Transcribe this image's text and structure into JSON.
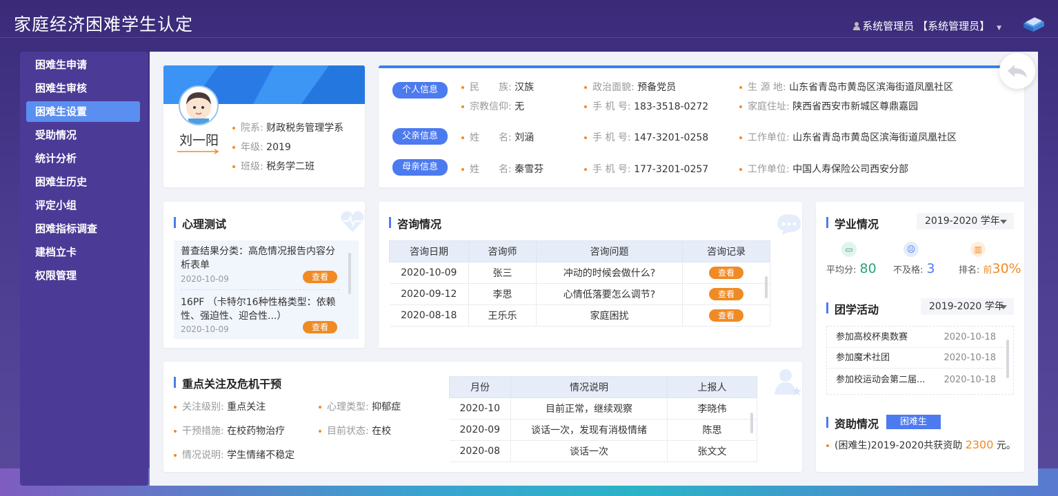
{
  "header": {
    "title": "家庭经济困难学生认定",
    "user": "系统管理员 【系统管理员】"
  },
  "sidebar": {
    "items": [
      {
        "label": "困难生申请"
      },
      {
        "label": "困难生审核"
      },
      {
        "label": "困难生设置"
      },
      {
        "label": "受助情况"
      },
      {
        "label": "统计分析"
      },
      {
        "label": "困难生历史"
      },
      {
        "label": "评定小组"
      },
      {
        "label": "困难指标调查"
      },
      {
        "label": "建档立卡"
      },
      {
        "label": "权限管理"
      }
    ],
    "active_index": 2
  },
  "profile": {
    "name": "刘一阳",
    "dept_label": "院系:",
    "dept": "财政税务管理学系",
    "grade_label": "年级:",
    "grade": "2019",
    "class_label": "班级:",
    "class": "税务学二班"
  },
  "personal": {
    "tag": "个人信息",
    "ethnic_label": "民　　族:",
    "ethnic": "汉族",
    "political_label": "政治面貌:",
    "political": "预备党员",
    "origin_label": "生 源 地:",
    "origin": "山东省青岛市黄岛区滨海街道凤凰社区",
    "religion_label": "宗教信仰:",
    "religion": "无",
    "phone_label": "手 机 号:",
    "phone": "183-3518-0272",
    "address_label": "家庭住址:",
    "address": "陕西省西安市新城区尊鼎嘉园"
  },
  "father": {
    "tag": "父亲信息",
    "name_label": "姓　　名:",
    "name": "刘涵",
    "phone_label": "手 机 号:",
    "phone": "147-3201-0258",
    "work_label": "工作单位:",
    "work": "山东省青岛市黄岛区滨海街道凤凰社区"
  },
  "mother": {
    "tag": "母亲信息",
    "name_label": "姓　　名:",
    "name": "秦雪芬",
    "phone_label": "手 机 号:",
    "phone": "177-3201-0257",
    "work_label": "工作单位:",
    "work": "中国人寿保险公司西安分部"
  },
  "psych": {
    "title": "心理测试",
    "view_label": "查看",
    "items": [
      {
        "text": "普查结果分类：高危情况报告内容分析表单",
        "date": "2020-10-09"
      },
      {
        "text": "16PF （卡特尔16种性格类型：依赖性、强迫性、迎合性...）",
        "date": "2020-10-09"
      }
    ]
  },
  "consult": {
    "title": "咨询情况",
    "headers": [
      "咨询日期",
      "咨询师",
      "咨询问题",
      "咨询记录"
    ],
    "view_label": "查看",
    "rows": [
      [
        "2020-10-09",
        "张三",
        "冲动的时候会做什么?"
      ],
      [
        "2020-09-12",
        "李思",
        "心情低落要怎么调节?"
      ],
      [
        "2020-08-18",
        "王乐乐",
        "家庭困扰"
      ]
    ]
  },
  "academic": {
    "title": "学业情况",
    "year": "2019-2020 学年",
    "avg_label": "平均分:",
    "avg": "80",
    "fail_label": "不及格:",
    "fail": "3",
    "rank_label": "排名:",
    "rank_prefix": "前",
    "rank": "30%"
  },
  "activity": {
    "title": "团学活动",
    "year": "2019-2020 学年",
    "items": [
      {
        "name": "参加高校杯奥数赛",
        "date": "2020-10-18"
      },
      {
        "name": "参加魔术社团",
        "date": "2020-10-18"
      },
      {
        "name": "参加校运动会第二届...",
        "date": "2020-10-18"
      }
    ]
  },
  "aid": {
    "title": "资助情况",
    "tag": "困难生",
    "text": "(困难生)2019-2020共获资助",
    "amount": "2300",
    "unit": "元。"
  },
  "focus": {
    "title": "重点关注及危机干预",
    "level_label": "关注级别:",
    "level": "重点关注",
    "type_label": "心理类型:",
    "type": "抑郁症",
    "measure_label": "干预措施:",
    "measure": "在校药物治疗",
    "status_label": "目前状态:",
    "status": "在校",
    "desc_label": "情况说明:",
    "desc": "学生情绪不稳定",
    "headers": [
      "月份",
      "情况说明",
      "上报人"
    ],
    "rows": [
      [
        "2020-10",
        "目前正常，继续观察",
        "李晓伟"
      ],
      [
        "2020-09",
        "谈话一次，发现有消极情绪",
        "陈思"
      ],
      [
        "2020-08",
        "谈话一次",
        "张文文"
      ]
    ]
  },
  "colors": {
    "accent": "#4c7bf0",
    "orange": "#f08a24",
    "green": "#2aa37a",
    "sidebar": "#4b3b96"
  }
}
